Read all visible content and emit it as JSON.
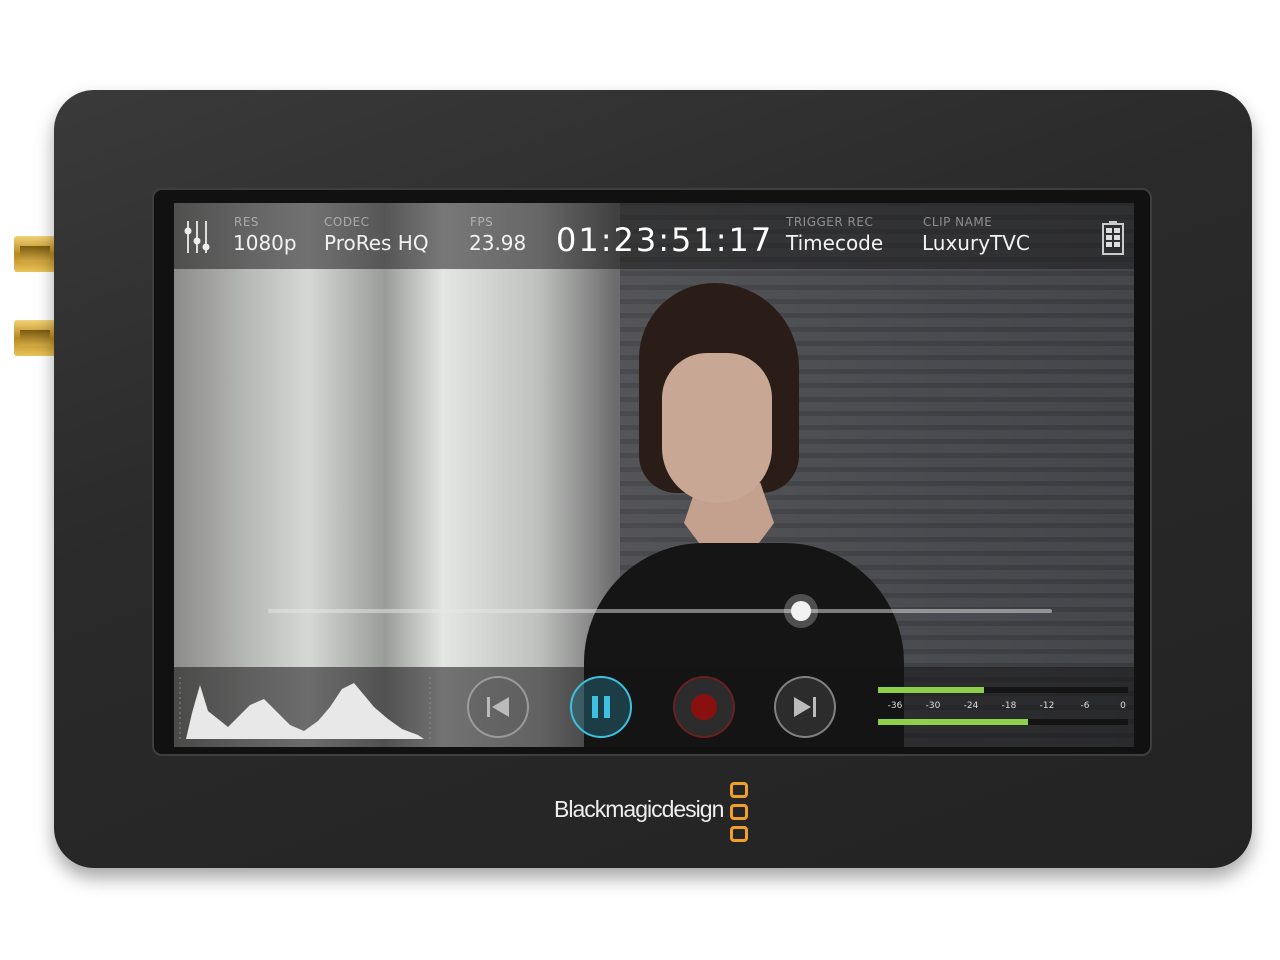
{
  "header": {
    "settings_icon": "sliders-icon",
    "res": {
      "label": "RES",
      "value": "1080p"
    },
    "codec": {
      "label": "CODEC",
      "value": "ProRes HQ"
    },
    "fps": {
      "label": "FPS",
      "value": "23.98"
    },
    "timecode": "01:23:51:17",
    "trigger": {
      "label": "TRIGGER REC",
      "value": "Timecode"
    },
    "clip": {
      "label": "CLIP NAME",
      "value": "LuxuryTVC"
    },
    "battery_icon": "battery-icon"
  },
  "playback": {
    "position": 0.68
  },
  "controls": [
    "skip-back",
    "pause",
    "record",
    "skip-forward"
  ],
  "audio_meter": {
    "scale": [
      "-36",
      "-30",
      "-24",
      "-18",
      "-12",
      "-6",
      "0"
    ],
    "channel_levels_db": [
      -22,
      -15
    ],
    "color": "#8dd14a"
  },
  "brand": {
    "name": "Blackmagicdesign",
    "accent": "#f0a02a"
  },
  "colors": {
    "pause_accent": "#3ec1e0",
    "record": "#8a1010"
  }
}
